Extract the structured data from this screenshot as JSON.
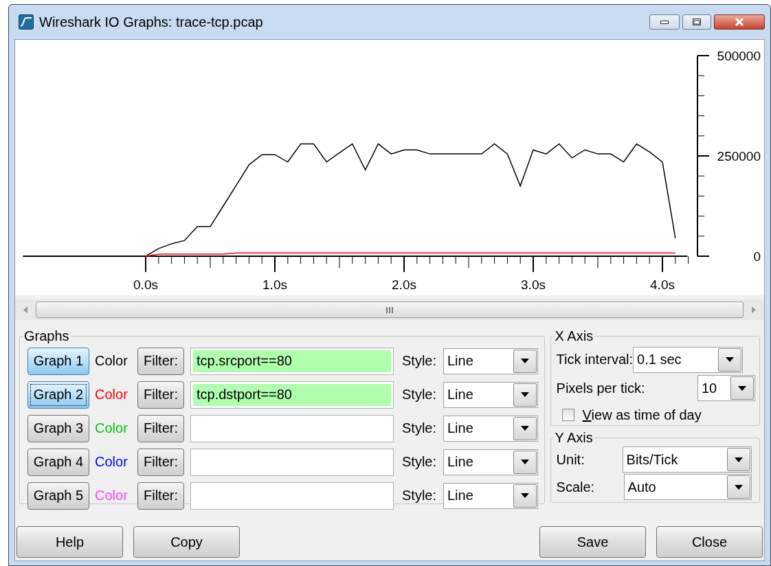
{
  "window": {
    "title": "Wireshark IO Graphs: trace-tcp.pcap"
  },
  "chart": {
    "chart_data": {
      "type": "line",
      "x": [
        -0.9,
        0.0,
        0.1,
        0.2,
        0.3,
        0.4,
        0.5,
        0.6,
        0.7,
        0.8,
        0.9,
        1.0,
        1.1,
        1.2,
        1.3,
        1.4,
        1.5,
        1.6,
        1.7,
        1.8,
        1.9,
        2.0,
        2.1,
        2.2,
        2.3,
        2.4,
        2.5,
        2.6,
        2.7,
        2.8,
        2.9,
        3.0,
        3.1,
        3.2,
        3.3,
        3.4,
        3.5,
        3.6,
        3.7,
        3.8,
        3.9,
        4.0,
        4.1
      ],
      "series": [
        {
          "color": "#000000",
          "values": [
            0,
            0,
            19000,
            31000,
            39000,
            74000,
            74000,
            125000,
            176000,
            228000,
            253000,
            253000,
            235000,
            280000,
            280000,
            235000,
            258000,
            280000,
            215000,
            280000,
            255000,
            265000,
            265000,
            255000,
            255000,
            255000,
            255000,
            255000,
            280000,
            255000,
            175000,
            265000,
            255000,
            280000,
            245000,
            265000,
            255000,
            255000,
            235000,
            280000,
            260000,
            235000,
            45000
          ]
        },
        {
          "color": "#ff0000",
          "values": [
            null,
            0,
            5000,
            5000,
            5000,
            5000,
            5000,
            5000,
            8000,
            8000,
            8000,
            8000,
            8000,
            8000,
            8000,
            8000,
            8000,
            8000,
            8000,
            8000,
            8000,
            8000,
            8000,
            8000,
            8000,
            8000,
            8000,
            8000,
            8000,
            8000,
            8000,
            8000,
            8000,
            8000,
            8000,
            8000,
            8000,
            8000,
            8000,
            8000,
            8000,
            8000,
            8000
          ]
        }
      ],
      "xlim": [
        -0.95,
        4.3
      ],
      "ylim": [
        0,
        500000
      ],
      "xticks": [
        {
          "value": 0,
          "label": "0.0s"
        },
        {
          "value": 1,
          "label": "1.0s"
        },
        {
          "value": 2,
          "label": "2.0s"
        },
        {
          "value": 3,
          "label": "3.0s"
        },
        {
          "value": 4,
          "label": "4.0s"
        }
      ],
      "yticks": [
        0,
        250000,
        500000
      ]
    }
  },
  "graphs": {
    "title": "Graphs",
    "rows": [
      {
        "button": "Graph 1",
        "on": true,
        "focused": false,
        "color_label": "Color",
        "color": "#000000",
        "filter_button": "Filter:",
        "filter": "tcp.srcport==80",
        "valid": true,
        "style_label": "Style:",
        "style": "Line"
      },
      {
        "button": "Graph 2",
        "on": true,
        "focused": true,
        "color_label": "Color",
        "color": "#ff0000",
        "filter_button": "Filter:",
        "filter": "tcp.dstport==80",
        "valid": true,
        "style_label": "Style:",
        "style": "Line"
      },
      {
        "button": "Graph 3",
        "on": false,
        "focused": false,
        "color_label": "Color",
        "color": "#00c800",
        "filter_button": "Filter:",
        "valid": false,
        "style_label": "Style:",
        "style": "Line"
      },
      {
        "button": "Graph 4",
        "on": false,
        "focused": false,
        "color_label": "Color",
        "color": "#0000ff",
        "filter_button": "Filter:",
        "valid": false,
        "style_label": "Style:",
        "style": "Line"
      },
      {
        "button": "Graph 5",
        "on": false,
        "focused": false,
        "color_label": "Color",
        "color": "#ff40ff",
        "filter_button": "Filter:",
        "valid": false,
        "style_label": "Style:",
        "style": "Line"
      }
    ]
  },
  "x_axis": {
    "title": "X Axis",
    "tick_interval_label": "Tick interval:",
    "tick_interval": "0.1 sec",
    "pixels_per_tick_label": "Pixels per tick:",
    "pixels_per_tick": "10",
    "time_of_day": {
      "label": "View as time of day",
      "checked": false
    }
  },
  "y_axis": {
    "title": "Y Axis",
    "unit_label": "Unit:",
    "unit": "Bits/Tick",
    "scale_label": "Scale:",
    "scale": "Auto"
  },
  "buttons": [
    "Help",
    "Copy",
    "Save",
    "Close"
  ]
}
